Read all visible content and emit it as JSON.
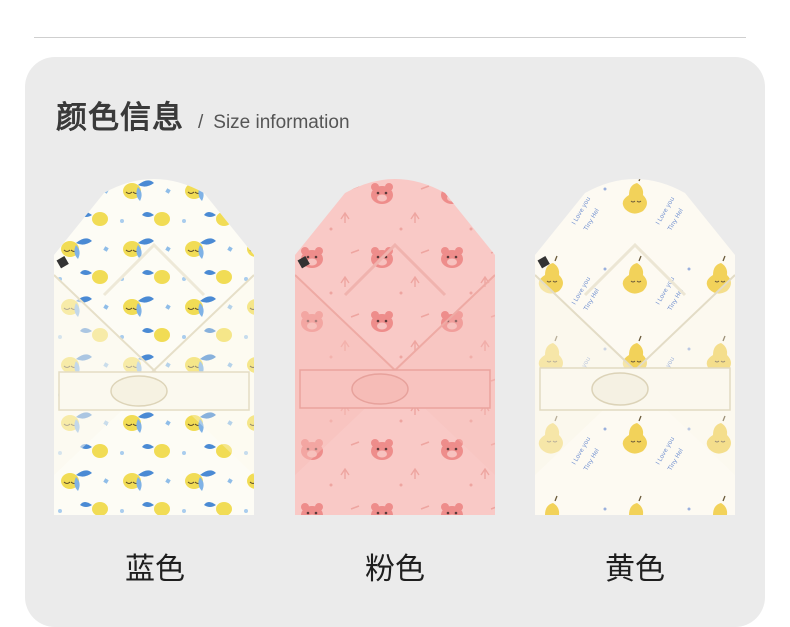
{
  "header": {
    "title_cn": "颜色信息",
    "separator": "/",
    "title_en": "Size information"
  },
  "products": [
    {
      "label": "蓝色",
      "fabric_color": "#fdfcf5",
      "print_color": "#f1dc55",
      "accent_color": "#3f86cf"
    },
    {
      "label": "粉色",
      "fabric_color": "#f9c9c6",
      "print_color": "#ee8d8b",
      "accent_color": "#e7a29c"
    },
    {
      "label": "黄色",
      "fabric_color": "#fdfaf2",
      "print_color": "#f2d25a",
      "accent_color": "#6f8fd0"
    }
  ]
}
